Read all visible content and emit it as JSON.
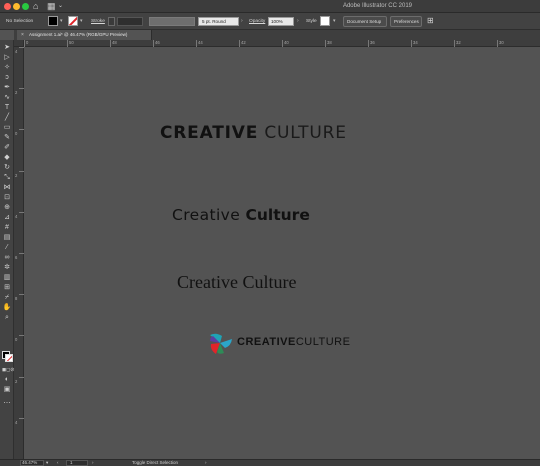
{
  "app": {
    "title": "Adobe Illustrator CC 2019",
    "menu_caret": "⌄"
  },
  "controlbar": {
    "selection": "No Selection",
    "stroke_label": "Stroke",
    "brush": "5 pt. Round",
    "opacity_label": "Opacity",
    "opacity_value": "100%",
    "style_label": "Style",
    "doc_setup": "Document Setup",
    "preferences": "Preferences"
  },
  "tab": {
    "close": "×",
    "name": "Assignment 1.ai* @ 46.47% (RGB/GPU Preview)"
  },
  "ruler": {
    "h_labels": [
      "0",
      "50",
      "48",
      "46",
      "44",
      "42",
      "40",
      "38",
      "36",
      "34",
      "32",
      "30"
    ],
    "v_labels": [
      "4",
      "2",
      "0",
      "2",
      "4",
      "6",
      "8",
      "0",
      "2",
      "4"
    ]
  },
  "canvas": {
    "logo1": {
      "bold": "CREATIVE",
      "light": " CULTURE"
    },
    "logo2": {
      "light": "Creative ",
      "bold": "Culture"
    },
    "logo3": {
      "text": "Creative Culture"
    },
    "logo4": {
      "bold": "CREATIVE",
      "light": "CULTURE",
      "colors": [
        "#1fa3b5",
        "#e0252a",
        "#2e8b57",
        "#5a3fa0"
      ]
    }
  },
  "status": {
    "zoom": "46.47%",
    "artboard": "1",
    "tool": "Toggle Direct Selection"
  }
}
